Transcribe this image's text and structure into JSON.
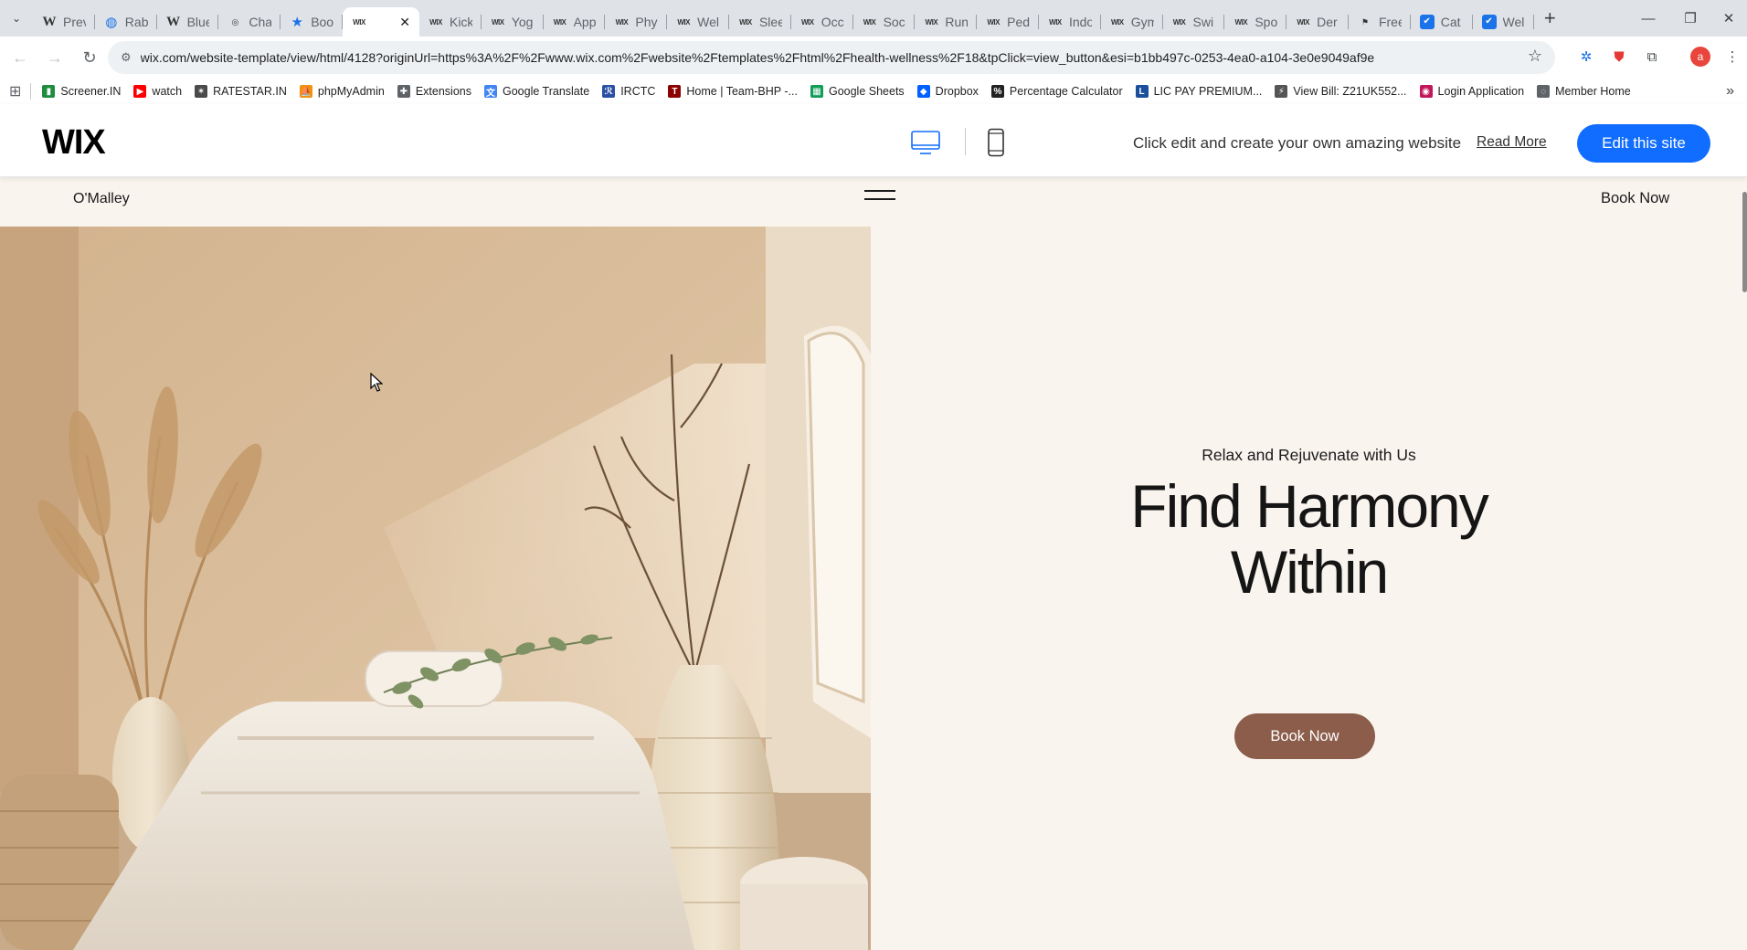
{
  "browser": {
    "tabs": [
      {
        "favicon": "wiki",
        "label": "Prev"
      },
      {
        "favicon": "globe",
        "label": "Rab"
      },
      {
        "favicon": "wiki",
        "label": "Blue"
      },
      {
        "favicon": "chatgpt",
        "label": "Chat"
      },
      {
        "favicon": "star",
        "label": "Boo"
      },
      {
        "favicon": "wix",
        "label": "",
        "active": true
      },
      {
        "favicon": "wix",
        "label": "Kick"
      },
      {
        "favicon": "wix",
        "label": "Yog"
      },
      {
        "favicon": "wix",
        "label": "App"
      },
      {
        "favicon": "wix",
        "label": "Phy"
      },
      {
        "favicon": "wix",
        "label": "Wel"
      },
      {
        "favicon": "wix",
        "label": "Slee"
      },
      {
        "favicon": "wix",
        "label": "Occ"
      },
      {
        "favicon": "wix",
        "label": "Soc"
      },
      {
        "favicon": "wix",
        "label": "Run"
      },
      {
        "favicon": "wix",
        "label": "Ped"
      },
      {
        "favicon": "wix",
        "label": "Indo"
      },
      {
        "favicon": "wix",
        "label": "Gym"
      },
      {
        "favicon": "wix",
        "label": "Swi"
      },
      {
        "favicon": "wix",
        "label": "Spo"
      },
      {
        "favicon": "wix",
        "label": "Der"
      },
      {
        "favicon": "flag",
        "label": "Free"
      },
      {
        "favicon": "blue-square",
        "label": "Cat"
      },
      {
        "favicon": "blue-square",
        "label": "Wel"
      }
    ],
    "new_tab": "+",
    "url": "wix.com/website-template/view/html/4128?originUrl=https%3A%2F%2Fwww.wix.com%2Fwebsite%2Ftemplates%2Fhtml%2Fhealth-wellness%2F18&tpClick=view_button&esi=b1bb497c-0253-4ea0-a104-3e0e9049af9e",
    "profile_initial": "a",
    "bookmarks": [
      {
        "icon": "bar-chart-icon",
        "color": "#1e8e3e",
        "label": "Screener.IN"
      },
      {
        "icon": "youtube-icon",
        "color": "#ff0000",
        "label": "watch"
      },
      {
        "icon": "ratestar-icon",
        "color": "#4a4a4a",
        "label": "RATESTAR.IN"
      },
      {
        "icon": "phpmyadmin-icon",
        "color": "#f29111",
        "label": "phpMyAdmin"
      },
      {
        "icon": "puzzle-icon",
        "color": "#5f6368",
        "label": "Extensions"
      },
      {
        "icon": "translate-icon",
        "color": "#4285f4",
        "label": "Google Translate"
      },
      {
        "icon": "irctc-icon",
        "color": "#2b4fa3",
        "label": "IRCTC"
      },
      {
        "icon": "teambhp-icon",
        "color": "#8b0000",
        "label": "Home | Team-BHP -..."
      },
      {
        "icon": "sheets-icon",
        "color": "#0f9d58",
        "label": "Google Sheets"
      },
      {
        "icon": "dropbox-icon",
        "color": "#0061ff",
        "label": "Dropbox"
      },
      {
        "icon": "percent-icon",
        "color": "#222222",
        "label": "Percentage Calculator"
      },
      {
        "icon": "lic-icon",
        "color": "#1a4f9c",
        "label": "LIC PAY PREMIUM..."
      },
      {
        "icon": "bill-icon",
        "color": "#555555",
        "label": "View Bill: Z21UK552..."
      },
      {
        "icon": "login-icon",
        "color": "#c2185b",
        "label": "Login Application"
      },
      {
        "icon": "globe-icon",
        "color": "#5f6368",
        "label": "Member Home"
      }
    ]
  },
  "wix_bar": {
    "logo": "WIX",
    "message": "Click edit and create your own amazing website",
    "read_more": "Read More",
    "edit_button": "Edit this site",
    "accent_color": "#116dff"
  },
  "site": {
    "brand": "O'Malley",
    "nav_book": "Book Now",
    "hero": {
      "tagline": "Relax and Rejuvenate with Us",
      "headline_line1": "Find Harmony",
      "headline_line2": "Within",
      "cta": "Book Now",
      "cta_color": "#8b5d4a",
      "background": "#faf4ef"
    }
  }
}
